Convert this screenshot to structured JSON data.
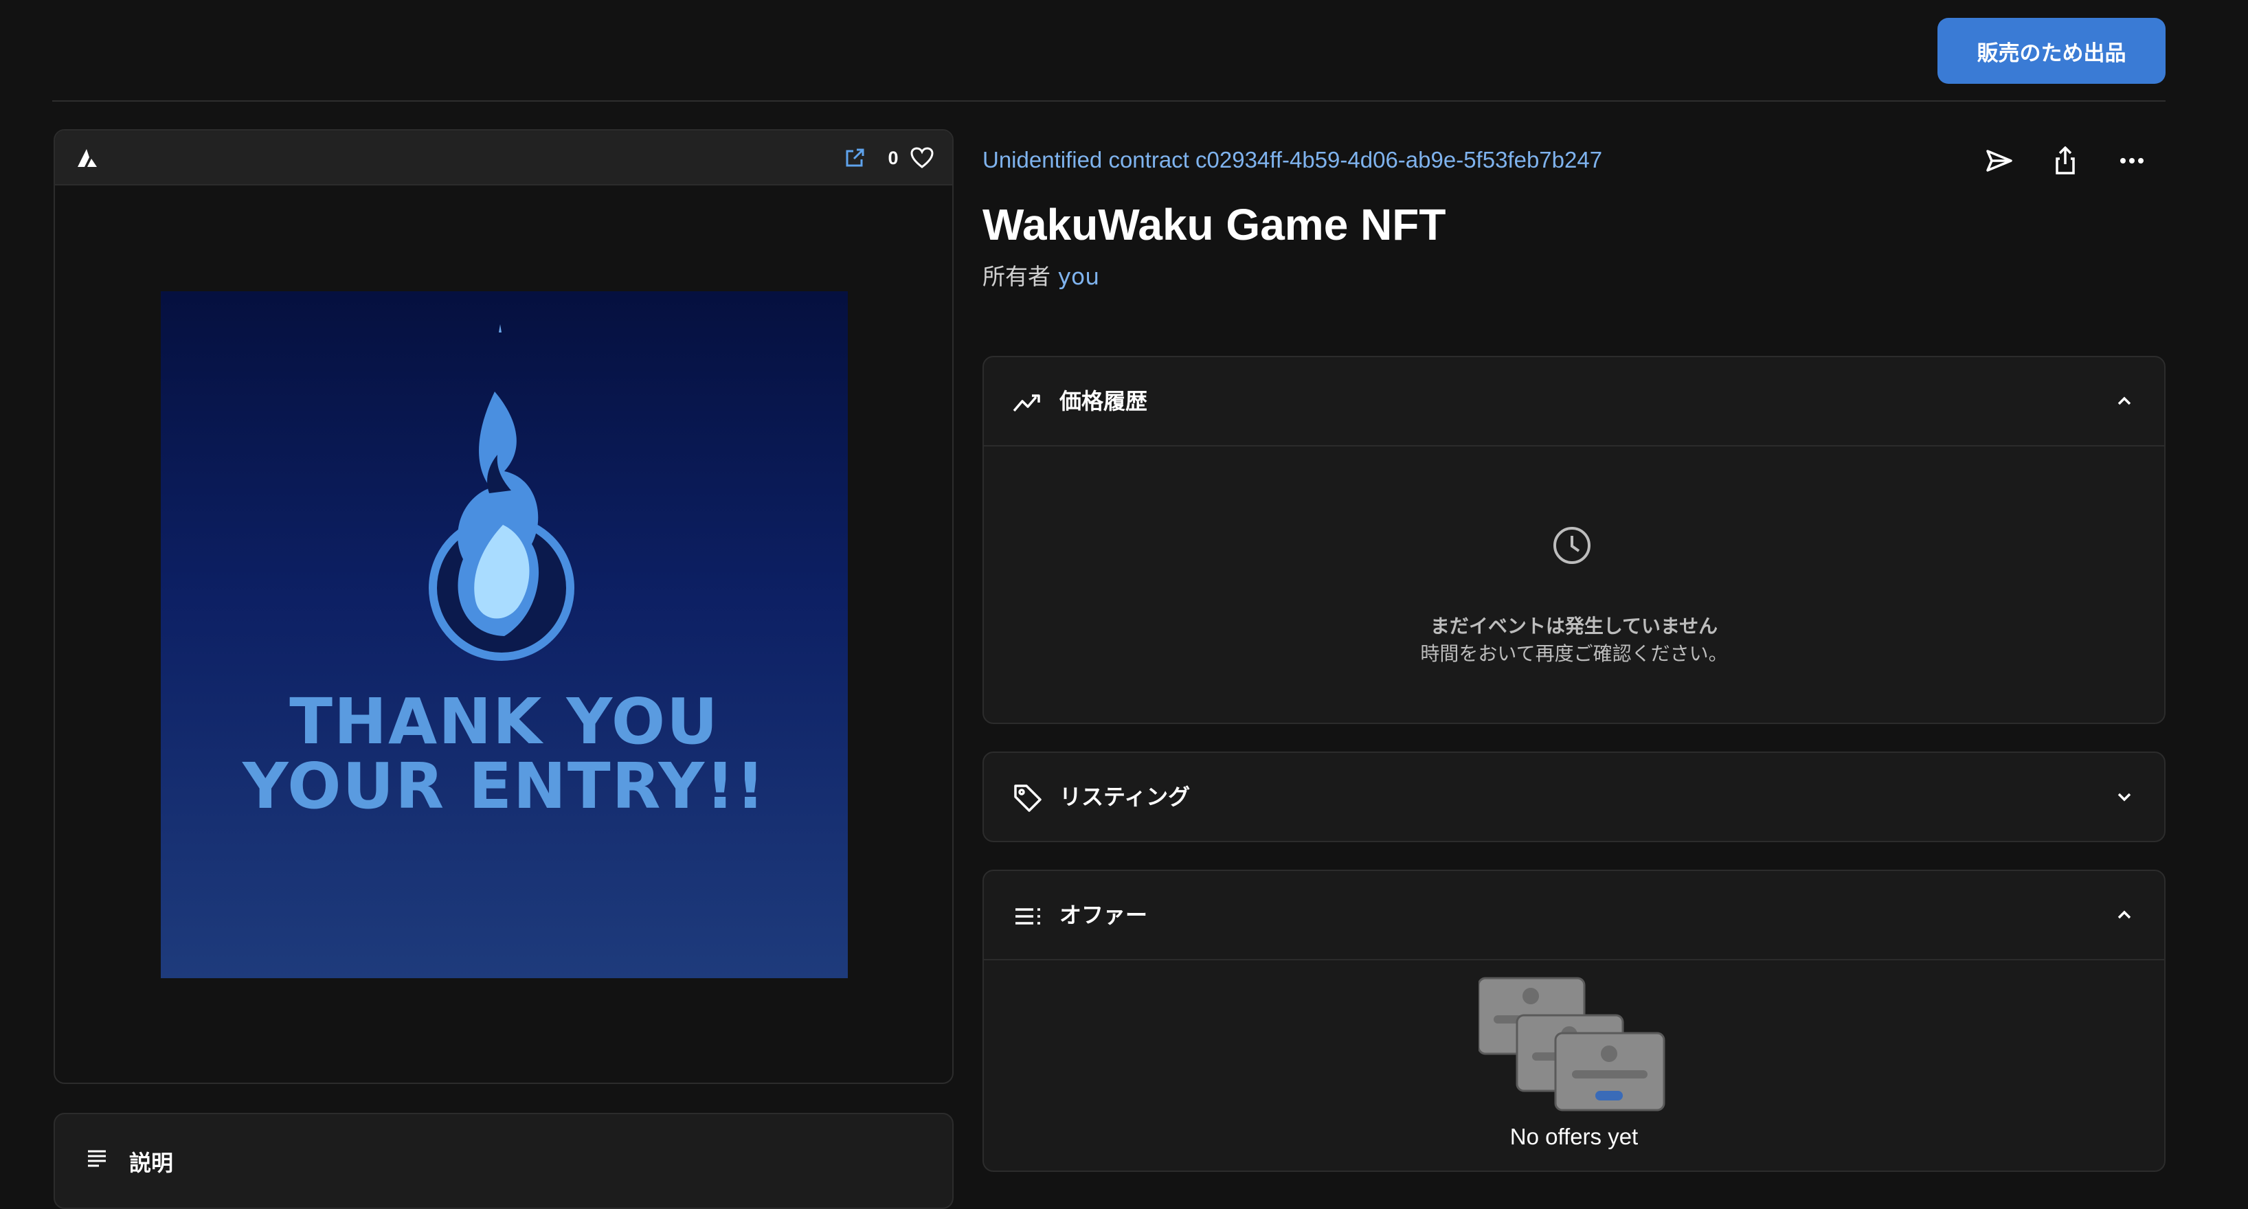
{
  "toolbar": {
    "sell_label": "販売のため出品"
  },
  "media": {
    "like_count": "0",
    "image_text_line1": "THANK YOU",
    "image_text_line2": "YOUR ENTRY!!",
    "image_colors": {
      "top": "#05103f",
      "bottom": "#1e3b7c",
      "text": "#5a9be0",
      "flame": "#4a8fe0",
      "flame_core": "#a9dcff"
    }
  },
  "description": {
    "title": "説明"
  },
  "asset": {
    "contract_label": "Unidentified contract c02934ff-4b59-4d06-ab9e-5f53feb7b247",
    "title": "WakuWaku Game NFT",
    "owner_prefix": "所有者",
    "owner_name": "you"
  },
  "panels": {
    "price_history": {
      "title": "価格履歴",
      "icon": "trending-up-icon",
      "expanded": true,
      "empty_title": "まだイベントは発生していません",
      "empty_subtitle": "時間をおいて再度ご確認ください。"
    },
    "listings": {
      "title": "リスティング",
      "icon": "tag-icon",
      "expanded": false
    },
    "offers": {
      "title": "オファー",
      "icon": "list-icon",
      "expanded": true,
      "empty_text": "No offers yet"
    }
  },
  "colors": {
    "accent": "#3a7bd5",
    "link": "#7fb3ee",
    "background": "#121212",
    "panel": "#1a1a1a",
    "border": "#2c2c2c"
  }
}
